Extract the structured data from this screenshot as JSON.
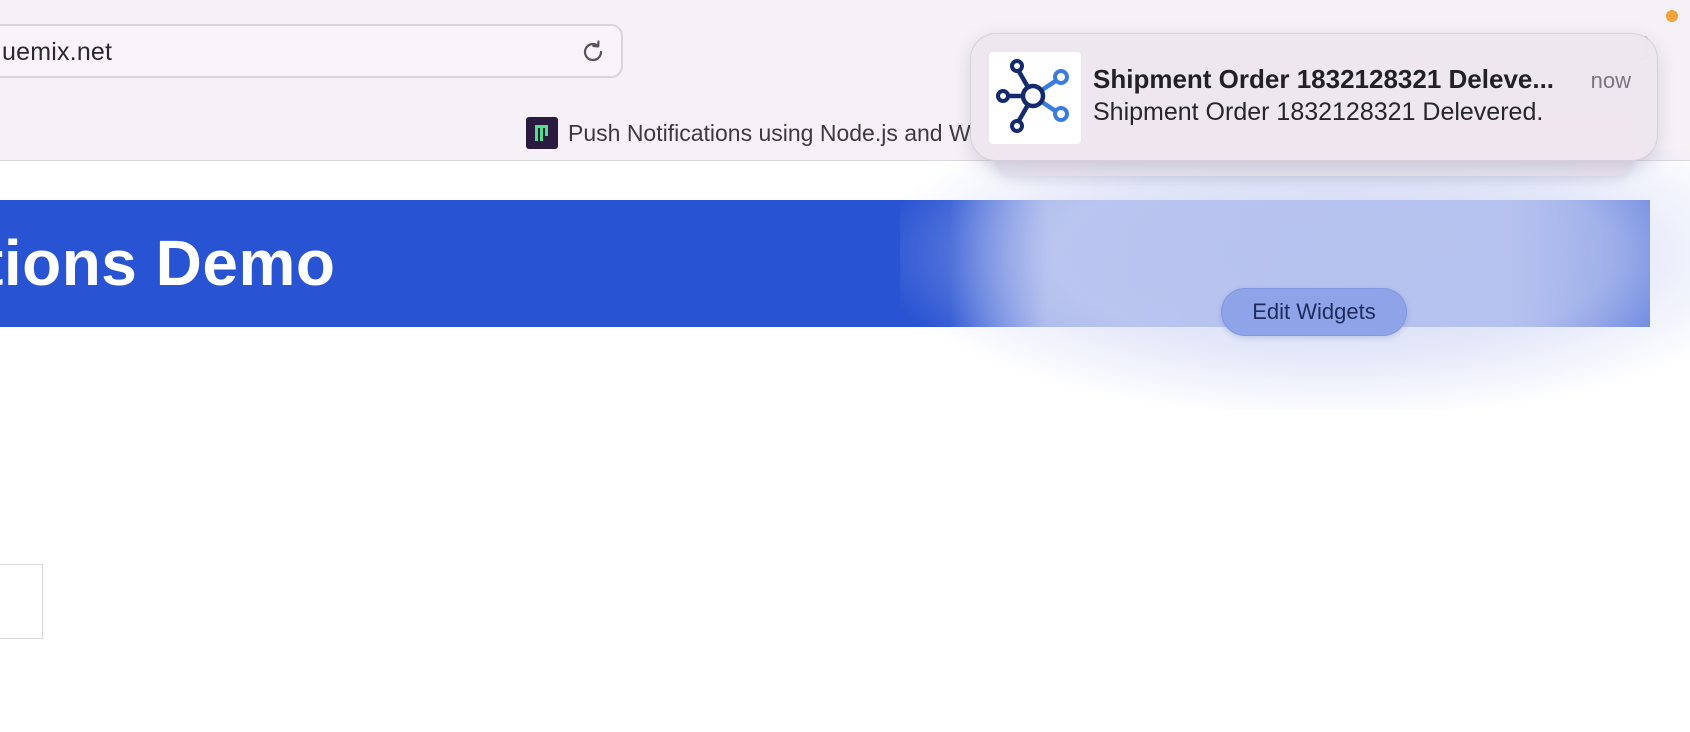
{
  "browser": {
    "address": "uemix.net",
    "bookmark_label": "Push Notifications using Node.js and W",
    "icons": {
      "reload": "reload-icon",
      "bookmark_favicon": "bookmark-favicon-icon"
    }
  },
  "page": {
    "header_title": "tions Demo",
    "header_color": "#2853d2"
  },
  "notification": {
    "title": "Shipment Order 1832128321 Deleve...",
    "time": "now",
    "body": "Shipment Order 1832128321 Delevered.",
    "app_icon": "network-hub-icon"
  },
  "widgets": {
    "edit_label": "Edit Widgets"
  },
  "colors": {
    "status_dot": "#f2a33a",
    "edit_button_bg": "#8fa4e8"
  }
}
